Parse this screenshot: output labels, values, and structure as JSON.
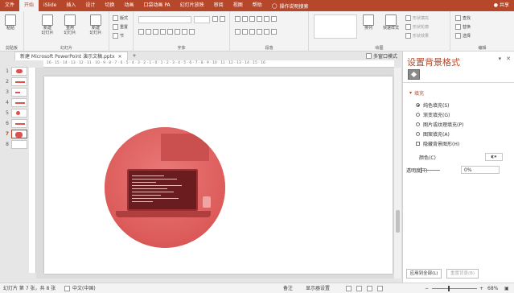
{
  "ribbon_tabs": [
    "文件",
    "开始",
    "iSlide",
    "插入",
    "设计",
    "切换",
    "动画",
    "口袋动画 PA",
    "幻灯片放映",
    "审阅",
    "视图",
    "帮助"
  ],
  "active_tab": "开始",
  "tell_me": "操作说明搜索",
  "share": "共享",
  "groups": {
    "clipboard": {
      "label": "剪贴板",
      "paste": "粘贴"
    },
    "slides": {
      "label": "幻灯片",
      "new_slide": "新建\n幻灯片",
      "reuse": "重用\n幻灯片",
      "new_slide2": "新建\n幻灯片",
      "layout": "版式",
      "reset": "重置",
      "section": "节"
    },
    "font": {
      "label": "字体"
    },
    "paragraph": {
      "label": "段落"
    },
    "drawing": {
      "label": "绘图",
      "arrange": "排列",
      "quick_styles": "快速样式",
      "fill": "形状填充",
      "outline": "形状轮廓",
      "effects": "形状效果"
    },
    "editing": {
      "label": "编辑",
      "find": "查找",
      "replace": "替换",
      "select": "选择"
    }
  },
  "doc_tab": "新建 Microsoft PowerPoint 演示文稿.pptx",
  "doc_tab_close": "×",
  "doc_tab_add": "+",
  "multi_window": "多窗口模式",
  "thumbnails": [
    {
      "num": "1",
      "mark": ""
    },
    {
      "num": "2",
      "mark": ""
    },
    {
      "num": "3",
      "mark": ""
    },
    {
      "num": "4",
      "mark": ""
    },
    {
      "num": "5",
      "mark": ""
    },
    {
      "num": "6",
      "mark": ""
    },
    {
      "num": "7",
      "mark": ""
    },
    {
      "num": "8",
      "mark": ""
    }
  ],
  "active_slide": "7",
  "ruler_text": "16 · 15 · 14 · 13 · 12 · 11 · 10 · 9 · 8 · 7 · 6 · 5 · 4 · 3 · 2 · 1 · 0 · 1 · 2 · 3 · 4 · 5 · 6 · 7 · 8 · 9 · 10 · 11 · 12 · 13 · 14 · 15 · 16",
  "pane": {
    "title": "设置背景格式",
    "section": "填充",
    "options": [
      {
        "label": "纯色填充(S)",
        "selected": true
      },
      {
        "label": "渐变填充(G)",
        "selected": false
      },
      {
        "label": "图片或纹理填充(P)",
        "selected": false
      },
      {
        "label": "图案填充(A)",
        "selected": false
      }
    ],
    "hide_bg": "隐藏背景图形(H)",
    "color_label": "颜色(C)",
    "transparency_label": "透明度(T)",
    "transparency_value": "0%",
    "apply_all": "应用到全部(L)",
    "reset_bg": "重置背景(B)"
  },
  "status": {
    "slide_info": "幻灯片 第 7 张，共 8 张",
    "language": "中文(中国)",
    "notes": "备注",
    "display": "显示器设置",
    "zoom": "68%"
  },
  "colors": {
    "accent": "#b7472a",
    "photo_tint": "#dc5b5a"
  }
}
